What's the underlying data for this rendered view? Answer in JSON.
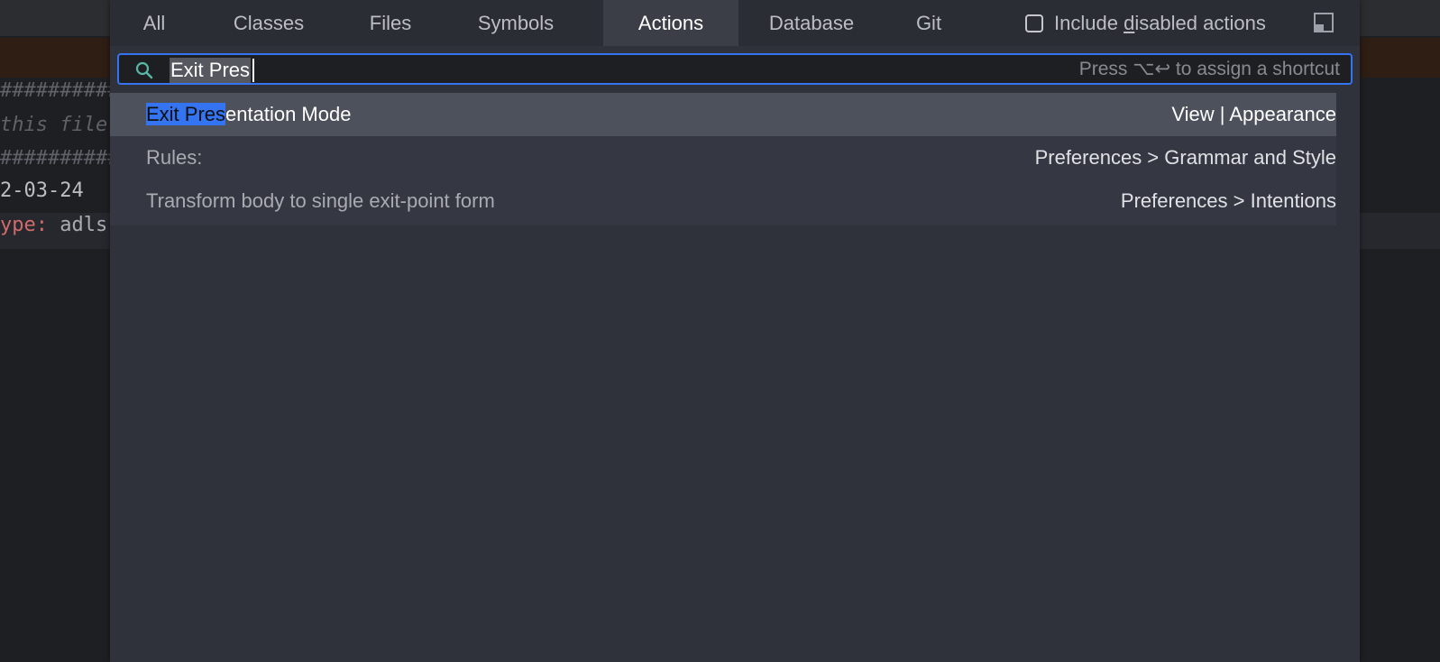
{
  "editor": {
    "lines": [
      {
        "kind": "hash",
        "text": "##########"
      },
      {
        "kind": "comment",
        "text": "this file"
      },
      {
        "kind": "hash",
        "text": "##########"
      },
      {
        "kind": "date",
        "text": "2-03-24"
      },
      {
        "kind": "keyval",
        "key": "ype",
        "sep": ": ",
        "val": "adls"
      }
    ]
  },
  "tabs": [
    {
      "label": "All",
      "active": false
    },
    {
      "label": "Classes",
      "active": false
    },
    {
      "label": "Files",
      "active": false
    },
    {
      "label": "Symbols",
      "active": false
    },
    {
      "label": "Actions",
      "active": true
    },
    {
      "label": "Database",
      "active": false
    },
    {
      "label": "Git",
      "active": false
    }
  ],
  "include_disabled": {
    "label_before": "Include ",
    "label_mnemonic": "d",
    "label_after": "isabled actions",
    "checked": false
  },
  "search": {
    "value": "Exit Pres",
    "shortcut_hint": "Press ⌥↩ to assign a shortcut"
  },
  "results": [
    {
      "match": "Exit Pres",
      "rest": "entation Mode",
      "location": "View | Appearance",
      "selected": true,
      "dim": false
    },
    {
      "match": "",
      "rest": "Rules:",
      "location": "Preferences > Grammar and Style",
      "selected": false,
      "dim": true
    },
    {
      "match": "",
      "rest": "Transform body to single exit-point form",
      "location": "Preferences > Intentions",
      "selected": false,
      "dim": true
    }
  ],
  "colors": {
    "accent": "#3574f0",
    "popup_bg": "#2f323b",
    "selected_row": "#4d515c",
    "editor_bg": "#1e1f22"
  },
  "icons": {
    "search": "search-icon",
    "preview": "preview-panel-icon"
  }
}
